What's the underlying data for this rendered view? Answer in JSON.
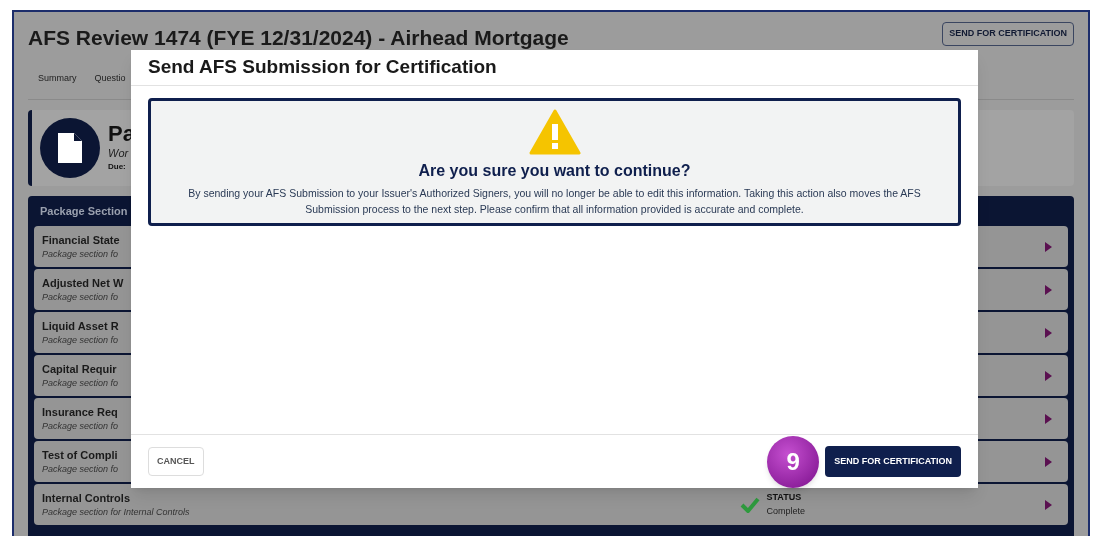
{
  "page": {
    "title": "AFS Review 1474 (FYE 12/31/2024) - Airhead Mortgage",
    "header_button": "SEND FOR CERTIFICATION",
    "tabs": [
      {
        "label": "Summary",
        "selected": false
      },
      {
        "label": "Questio",
        "selected": false
      }
    ],
    "package_card": {
      "title": "Pa",
      "subtitle": "Wor",
      "due_label": "Due:"
    },
    "sections_header": "Package Section",
    "sections": [
      {
        "title": "Financial State",
        "subtitle": "Package section fo"
      },
      {
        "title": "Adjusted Net W",
        "subtitle": "Package section fo"
      },
      {
        "title": "Liquid Asset R",
        "subtitle": "Package section fo"
      },
      {
        "title": "Capital Requir",
        "subtitle": "Package section fo"
      },
      {
        "title": "Insurance Req",
        "subtitle": "Package section fo"
      },
      {
        "title": "Test of Compli",
        "subtitle": "Package section fo"
      },
      {
        "title": "Internal Controls",
        "subtitle": "Package section for Internal Controls",
        "status_label": "STATUS",
        "status": "Complete"
      }
    ]
  },
  "dialog": {
    "title": "Send AFS Submission for Certification",
    "alert_heading": "Are you sure you want to continue?",
    "alert_text": "By sending your AFS Submission to your Issuer's Authorized Signers, you will no longer be able to edit this information. Taking this action also moves the AFS Submission process to the next step. Please confirm that all information provided is accurate and complete.",
    "cancel_button": "CANCEL",
    "step_badge": "9",
    "confirm_button": "SEND FOR CERTIFICATION"
  }
}
